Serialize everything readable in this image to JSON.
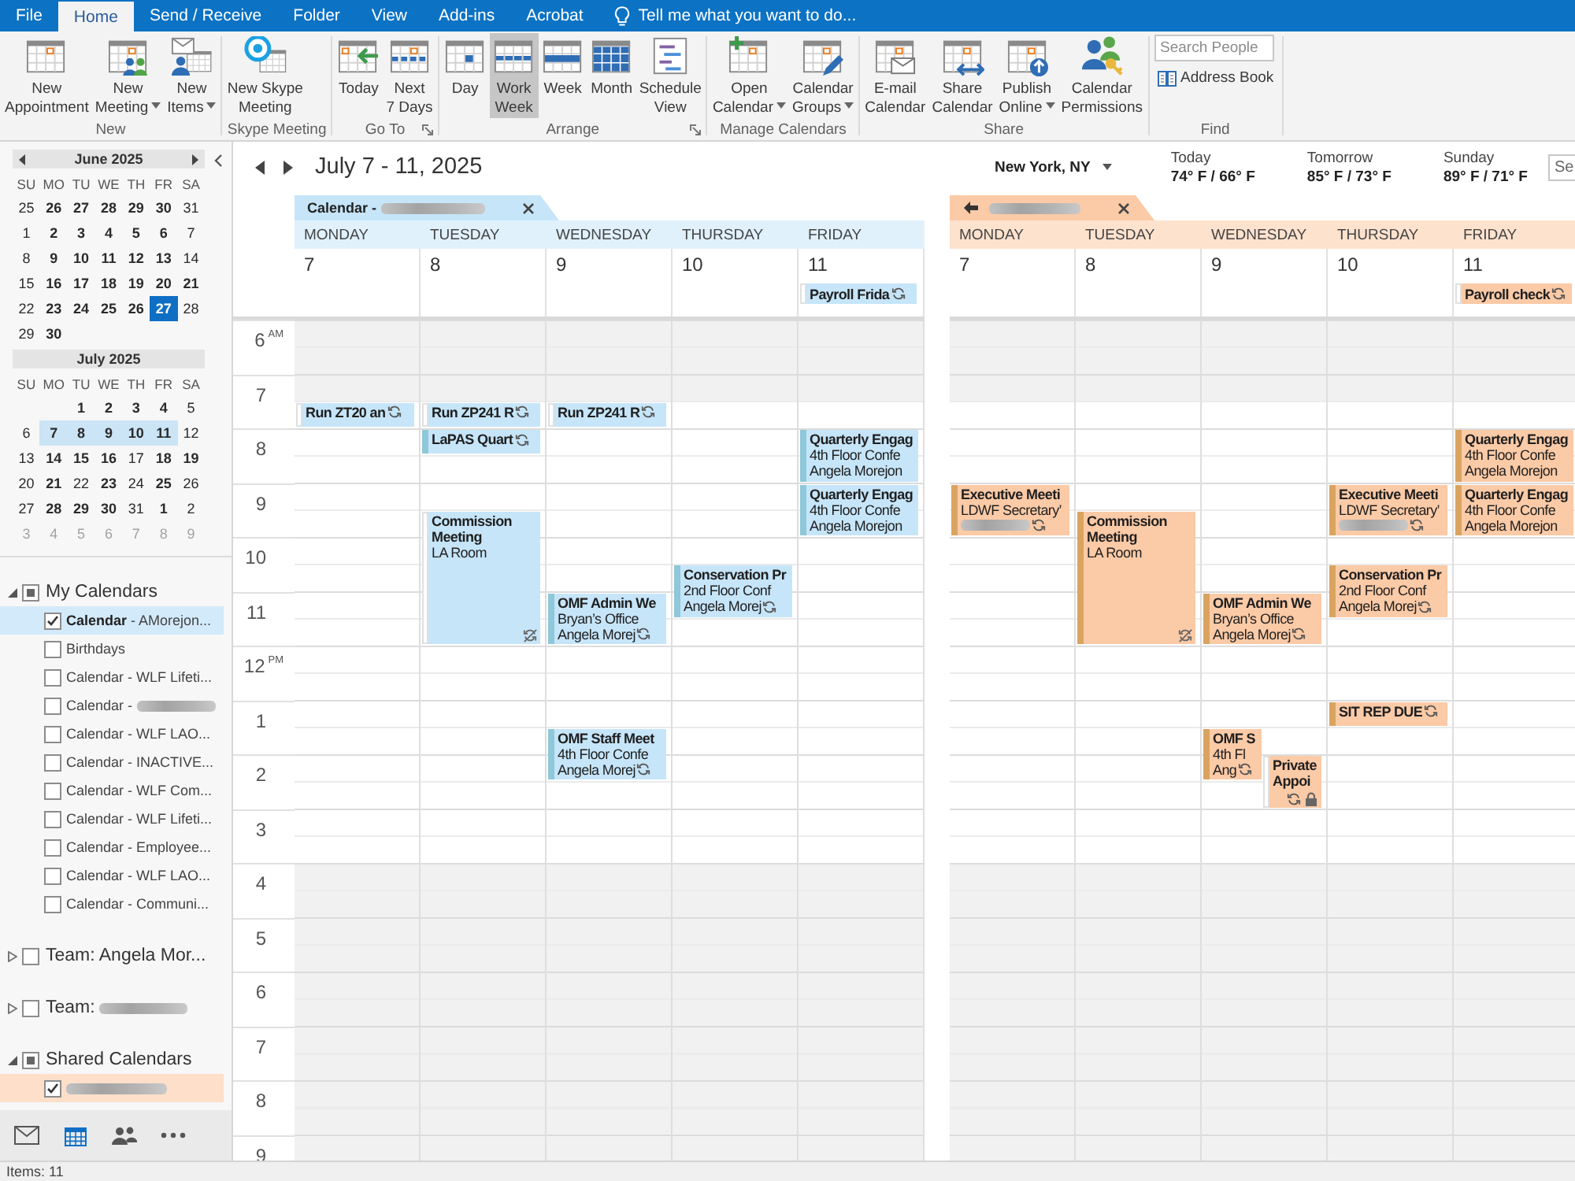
{
  "tabs": [
    {
      "label": "File",
      "selected": false
    },
    {
      "label": "Home",
      "selected": true
    },
    {
      "label": "Send / Receive",
      "selected": false
    },
    {
      "label": "Folder",
      "selected": false
    },
    {
      "label": "View",
      "selected": false
    },
    {
      "label": "Add-ins",
      "selected": false
    },
    {
      "label": "Acrobat",
      "selected": false
    }
  ],
  "tell_me": {
    "placeholder": "Tell me what you want to do..."
  },
  "ribbon": {
    "groups": [
      {
        "label": "New",
        "launcher": false,
        "buttons": [
          {
            "kind": "appointment",
            "label": "New\nAppointment",
            "dropdown": false
          },
          {
            "kind": "meeting",
            "label": "New\nMeeting",
            "dropdown": true
          },
          {
            "kind": "items",
            "label": "New\nItems",
            "dropdown": true
          }
        ]
      },
      {
        "label": "Skype Meeting",
        "launcher": false,
        "buttons": [
          {
            "kind": "skype",
            "label": "New Skype\nMeeting",
            "dropdown": false
          }
        ]
      },
      {
        "label": "Go To",
        "launcher": true,
        "buttons": [
          {
            "kind": "today",
            "label": "Today",
            "dropdown": false
          },
          {
            "kind": "next7",
            "label": "Next\n7 Days",
            "dropdown": false
          }
        ]
      },
      {
        "label": "Arrange",
        "launcher": true,
        "buttons": [
          {
            "kind": "day",
            "label": "Day",
            "dropdown": false,
            "selected": false
          },
          {
            "kind": "workweek",
            "label": "Work\nWeek",
            "dropdown": false,
            "selected": true
          },
          {
            "kind": "week",
            "label": "Week",
            "dropdown": false,
            "selected": false
          },
          {
            "kind": "month",
            "label": "Month",
            "dropdown": false,
            "selected": false
          },
          {
            "kind": "schedule",
            "label": "Schedule\nView",
            "dropdown": false,
            "selected": false
          }
        ]
      },
      {
        "label": "Manage Calendars",
        "launcher": false,
        "buttons": [
          {
            "kind": "open",
            "label": "Open\nCalendar",
            "dropdown": true
          },
          {
            "kind": "groups",
            "label": "Calendar\nGroups",
            "dropdown": true
          }
        ]
      },
      {
        "label": "Share",
        "launcher": false,
        "buttons": [
          {
            "kind": "email",
            "label": "E-mail\nCalendar",
            "dropdown": false
          },
          {
            "kind": "share",
            "label": "Share\nCalendar",
            "dropdown": false
          },
          {
            "kind": "publish",
            "label": "Publish\nOnline",
            "dropdown": true
          },
          {
            "kind": "permissions",
            "label": "Calendar\nPermissions",
            "dropdown": false
          }
        ]
      },
      {
        "label": "Find",
        "launcher": false,
        "search": {
          "placeholder": "Search People"
        },
        "links": [
          {
            "kind": "address-book",
            "label": "Address Book"
          }
        ]
      }
    ]
  },
  "navigator": {
    "months": [
      {
        "title": "June 2025",
        "arrows": true,
        "weekdays": [
          "SU",
          "MO",
          "TU",
          "WE",
          "TH",
          "FR",
          "SA"
        ],
        "weeks": [
          {
            "days": [
              {
                "day": "25",
                "bold": false,
                "muted": false,
                "selected": false,
                "today": false
              },
              {
                "day": "26",
                "bold": true,
                "muted": false,
                "selected": false,
                "today": false
              },
              {
                "day": "27",
                "bold": true,
                "muted": false,
                "selected": false,
                "today": false
              },
              {
                "day": "28",
                "bold": true,
                "muted": false,
                "selected": false,
                "today": false
              },
              {
                "day": "29",
                "bold": true,
                "muted": false,
                "selected": false,
                "today": false
              },
              {
                "day": "30",
                "bold": true,
                "muted": false,
                "selected": false,
                "today": false
              },
              {
                "day": "31",
                "bold": false,
                "muted": false,
                "selected": false,
                "today": false
              }
            ]
          },
          {
            "days": [
              {
                "day": "1",
                "bold": false,
                "muted": false,
                "selected": false,
                "today": false
              },
              {
                "day": "2",
                "bold": true,
                "muted": false,
                "selected": false,
                "today": false
              },
              {
                "day": "3",
                "bold": true,
                "muted": false,
                "selected": false,
                "today": false
              },
              {
                "day": "4",
                "bold": true,
                "muted": false,
                "selected": false,
                "today": false
              },
              {
                "day": "5",
                "bold": true,
                "muted": false,
                "selected": false,
                "today": false
              },
              {
                "day": "6",
                "bold": true,
                "muted": false,
                "selected": false,
                "today": false
              },
              {
                "day": "7",
                "bold": false,
                "muted": false,
                "selected": false,
                "today": false
              }
            ]
          },
          {
            "days": [
              {
                "day": "8",
                "bold": false,
                "muted": false,
                "selected": false,
                "today": false
              },
              {
                "day": "9",
                "bold": true,
                "muted": false,
                "selected": false,
                "today": false
              },
              {
                "day": "10",
                "bold": true,
                "muted": false,
                "selected": false,
                "today": false
              },
              {
                "day": "11",
                "bold": true,
                "muted": false,
                "selected": false,
                "today": false
              },
              {
                "day": "12",
                "bold": true,
                "muted": false,
                "selected": false,
                "today": false
              },
              {
                "day": "13",
                "bold": true,
                "muted": false,
                "selected": false,
                "today": false
              },
              {
                "day": "14",
                "bold": false,
                "muted": false,
                "selected": false,
                "today": false
              }
            ]
          },
          {
            "days": [
              {
                "day": "15",
                "bold": false,
                "muted": false,
                "selected": false,
                "today": false
              },
              {
                "day": "16",
                "bold": true,
                "muted": false,
                "selected": false,
                "today": false
              },
              {
                "day": "17",
                "bold": true,
                "muted": false,
                "selected": false,
                "today": false
              },
              {
                "day": "18",
                "bold": true,
                "muted": false,
                "selected": false,
                "today": false
              },
              {
                "day": "19",
                "bold": true,
                "muted": false,
                "selected": false,
                "today": false
              },
              {
                "day": "20",
                "bold": true,
                "muted": false,
                "selected": false,
                "today": false
              },
              {
                "day": "21",
                "bold": true,
                "muted": false,
                "selected": false,
                "today": false
              }
            ]
          },
          {
            "days": [
              {
                "day": "22",
                "bold": false,
                "muted": false,
                "selected": false,
                "today": false
              },
              {
                "day": "23",
                "bold": true,
                "muted": false,
                "selected": false,
                "today": false
              },
              {
                "day": "24",
                "bold": true,
                "muted": false,
                "selected": false,
                "today": false
              },
              {
                "day": "25",
                "bold": true,
                "muted": false,
                "selected": false,
                "today": false
              },
              {
                "day": "26",
                "bold": true,
                "muted": false,
                "selected": false,
                "today": false
              },
              {
                "day": "27",
                "bold": true,
                "muted": false,
                "selected": false,
                "today": true
              },
              {
                "day": "28",
                "bold": false,
                "muted": false,
                "selected": false,
                "today": false
              }
            ]
          },
          {
            "days": [
              {
                "day": "29",
                "bold": false,
                "muted": false,
                "selected": false,
                "today": false
              },
              {
                "day": "30",
                "bold": true,
                "muted": false,
                "selected": false,
                "today": false
              }
            ]
          }
        ]
      },
      {
        "title": "July 2025",
        "arrows": false,
        "weekdays": [
          "SU",
          "MO",
          "TU",
          "WE",
          "TH",
          "FR",
          "SA"
        ],
        "weeks": [
          {
            "trailing": true,
            "days": [
              {
                "day": "1",
                "bold": true,
                "muted": false,
                "selected": false,
                "today": false
              },
              {
                "day": "2",
                "bold": true,
                "muted": false,
                "selected": false,
                "today": false
              },
              {
                "day": "3",
                "bold": true,
                "muted": false,
                "selected": false,
                "today": false
              },
              {
                "day": "4",
                "bold": true,
                "muted": false,
                "selected": false,
                "today": false
              },
              {
                "day": "5",
                "bold": false,
                "muted": false,
                "selected": false,
                "today": false
              }
            ]
          },
          {
            "days": [
              {
                "day": "6",
                "bold": false,
                "muted": false,
                "selected": false,
                "today": false
              },
              {
                "day": "7",
                "bold": true,
                "muted": false,
                "selected": true,
                "today": false
              },
              {
                "day": "8",
                "bold": true,
                "muted": false,
                "selected": true,
                "today": false
              },
              {
                "day": "9",
                "bold": true,
                "muted": false,
                "selected": true,
                "today": false
              },
              {
                "day": "10",
                "bold": true,
                "muted": false,
                "selected": true,
                "today": false
              },
              {
                "day": "11",
                "bold": true,
                "muted": false,
                "selected": true,
                "today": false
              },
              {
                "day": "12",
                "bold": false,
                "muted": false,
                "selected": false,
                "today": false
              }
            ]
          },
          {
            "days": [
              {
                "day": "13",
                "bold": false,
                "muted": false,
                "selected": false,
                "today": false
              },
              {
                "day": "14",
                "bold": true,
                "muted": false,
                "selected": false,
                "today": false
              },
              {
                "day": "15",
                "bold": true,
                "muted": false,
                "selected": false,
                "today": false
              },
              {
                "day": "16",
                "bold": true,
                "muted": false,
                "selected": false,
                "today": false
              },
              {
                "day": "17",
                "bold": false,
                "muted": false,
                "selected": false,
                "today": false
              },
              {
                "day": "18",
                "bold": true,
                "muted": false,
                "selected": false,
                "today": false
              },
              {
                "day": "19",
                "bold": true,
                "muted": false,
                "selected": false,
                "today": false
              }
            ]
          },
          {
            "days": [
              {
                "day": "20",
                "bold": false,
                "muted": false,
                "selected": false,
                "today": false
              },
              {
                "day": "21",
                "bold": true,
                "muted": false,
                "selected": false,
                "today": false
              },
              {
                "day": "22",
                "bold": false,
                "muted": false,
                "selected": false,
                "today": false
              },
              {
                "day": "23",
                "bold": true,
                "muted": false,
                "selected": false,
                "today": false
              },
              {
                "day": "24",
                "bold": false,
                "muted": false,
                "selected": false,
                "today": false
              },
              {
                "day": "25",
                "bold": true,
                "muted": false,
                "selected": false,
                "today": false
              },
              {
                "day": "26",
                "bold": false,
                "muted": false,
                "selected": false,
                "today": false
              }
            ]
          },
          {
            "days": [
              {
                "day": "27",
                "bold": false,
                "muted": false,
                "selected": false,
                "today": false
              },
              {
                "day": "28",
                "bold": true,
                "muted": false,
                "selected": false,
                "today": false
              },
              {
                "day": "29",
                "bold": true,
                "muted": false,
                "selected": false,
                "today": false
              },
              {
                "day": "30",
                "bold": true,
                "muted": false,
                "selected": false,
                "today": false
              },
              {
                "day": "31",
                "bold": false,
                "muted": false,
                "selected": false,
                "today": false
              },
              {
                "day": "1",
                "bold": true,
                "muted": false,
                "selected": false,
                "today": false
              },
              {
                "day": "2",
                "bold": false,
                "muted": false,
                "selected": false,
                "today": false
              }
            ]
          },
          {
            "days": [
              {
                "day": "3",
                "bold": false,
                "muted": true,
                "selected": false,
                "today": false
              },
              {
                "day": "4",
                "bold": false,
                "muted": true,
                "selected": false,
                "today": false
              },
              {
                "day": "5",
                "bold": false,
                "muted": true,
                "selected": false,
                "today": false
              },
              {
                "day": "6",
                "bold": false,
                "muted": true,
                "selected": false,
                "today": false
              },
              {
                "day": "7",
                "bold": false,
                "muted": true,
                "selected": false,
                "today": false
              },
              {
                "day": "8",
                "bold": false,
                "muted": true,
                "selected": false,
                "today": false
              },
              {
                "day": "9",
                "bold": false,
                "muted": true,
                "selected": false,
                "today": false
              }
            ]
          }
        ]
      }
    ]
  },
  "folders": [
    {
      "label": "My Calendars",
      "expanded": true,
      "checked": true,
      "partial": true,
      "items": [
        {
          "label": "**Calendar** - AMorejon...",
          "checked": true,
          "color": "#d3eafa"
        },
        {
          "label": "Birthdays",
          "checked": false
        },
        {
          "label": "Calendar - WLF Lifeti...",
          "checked": false
        },
        {
          "label": "Calendar -",
          "redacted": true,
          "checked": false
        },
        {
          "label": "Calendar - WLF LAO...",
          "checked": false
        },
        {
          "label": "Calendar - INACTIVE...",
          "checked": false
        },
        {
          "label": "Calendar - WLF Com...",
          "checked": false
        },
        {
          "label": "Calendar - WLF Lifeti...",
          "checked": false
        },
        {
          "label": "Calendar - Employee...",
          "checked": false
        },
        {
          "label": "Calendar - WLF LAO...",
          "checked": false
        },
        {
          "label": "Calendar - Communi...",
          "checked": false
        }
      ]
    },
    {
      "label": "Team: Angela Mor...",
      "expanded": false,
      "checked": false
    },
    {
      "label": "Team:",
      "redacted": true,
      "expanded": false,
      "checked": false
    },
    {
      "label": "Shared Calendars",
      "expanded": true,
      "checked": true,
      "partial": true,
      "items": [
        {
          "redacted": true,
          "checked": true,
          "color": "#fddfca"
        }
      ]
    }
  ],
  "nav": [
    {
      "kind": "mail",
      "selected": false
    },
    {
      "kind": "calendar",
      "selected": true
    },
    {
      "kind": "people",
      "selected": false
    },
    {
      "kind": "more",
      "selected": false
    }
  ],
  "calendar": {
    "range": "July 7 - 11, 2025",
    "weather": {
      "location": "New York, NY",
      "forecast": [
        {
          "day": "Today",
          "temps": "74° F / 66° F"
        },
        {
          "day": "Tomorrow",
          "temps": "85° F / 73° F"
        },
        {
          "day": "Sunday",
          "temps": "89° F / 71° F"
        }
      ]
    },
    "search": {
      "placeholder": "Se"
    },
    "panes": [
      {
        "color": "#c6e5f9",
        "tab": {
          "label": "Calendar -",
          "redacted": true,
          "arrow": false
        },
        "time_labels": [
          "6$^{AM}$",
          "7",
          "8",
          "9",
          "10",
          "11",
          "12$^{PM}$",
          "1",
          "2",
          "3",
          "4",
          "5",
          "6",
          "7",
          "8",
          "9"
        ],
        "days": [
          {
            "name": "MONDAY",
            "date": "7",
            "events": [
              {
                "title": "Run ZT20 an",
                "busy": false,
                "recurring": true
              }
            ]
          },
          {
            "name": "TUESDAY",
            "date": "8",
            "events": [
              {
                "title": "Run ZP241 R",
                "busy": false,
                "recurring": true
              },
              {
                "title": "LaPAS Quart",
                "busy": true,
                "recurring": true
              },
              {
                "title": "Commission Meeting",
                "details": [
                  "LA Room"
                ],
                "busy": false,
                "recurring": true,
                "exception": true
              }
            ]
          },
          {
            "name": "WEDNESDAY",
            "date": "9",
            "events": [
              {
                "title": "Run ZP241 R",
                "busy": false,
                "recurring": true
              },
              {
                "title": "OMF Admin We",
                "details": [
                  "Bryan’s Office",
                  "Angela Morej"
                ],
                "busy": true,
                "recurring": true
              },
              {
                "title": "OMF Staff Meet",
                "details": [
                  "4th Floor Confe",
                  "Angela Morej"
                ],
                "busy": true,
                "recurring": true
              }
            ]
          },
          {
            "name": "THURSDAY",
            "date": "10",
            "events": [
              {
                "title": "Conservation Pr",
                "details": [
                  "2nd Floor Conf",
                  "Angela Morej"
                ],
                "busy": true,
                "recurring": true
              }
            ]
          },
          {
            "name": "FRIDAY",
            "date": "11",
            "all_day": [
              {
                "title": "Payroll Frida",
                "busy": false,
                "recurring": true
              }
            ],
            "events": [
              {
                "title": "Quarterly Engag",
                "details": [
                  "4th Floor Confe",
                  "Angela Morejon"
                ],
                "busy": true,
                "recurring": false
              },
              {
                "title": "Quarterly Engag",
                "details": [
                  "4th Floor Confe",
                  "Angela Morejon"
                ],
                "busy": true,
                "recurring": false
              }
            ]
          }
        ]
      },
      {
        "color": "#fbcaa6",
        "tab": {
          "redacted": true,
          "arrow": true
        },
        "days": [
          {
            "name": "MONDAY",
            "date": "7",
            "events": [
              {
                "title": "Executive Meeti",
                "details": [
                  "LDWF Secretary’"
                ],
                "redacted": true,
                "busy": true,
                "recurring": true
              }
            ]
          },
          {
            "name": "TUESDAY",
            "date": "8",
            "events": [
              {
                "title": "Commission Meeting",
                "details": [
                  "LA Room"
                ],
                "busy": true,
                "recurring": true,
                "exception": true
              }
            ]
          },
          {
            "name": "WEDNESDAY",
            "date": "9",
            "events": [
              {
                "title": "OMF Admin We",
                "details": [
                  "Bryan’s Office",
                  "Angela Morej"
                ],
                "busy": true,
                "recurring": true
              },
              {
                "title": "OMF S",
                "details": [
                  "4th Fl",
                  "Ang"
                ],
                "busy": true,
                "recurring": true
              },
              {
                "title": "Private Appoi",
                "busy": false,
                "recurring": true,
                "private": true
              }
            ]
          },
          {
            "name": "THURSDAY",
            "date": "10",
            "events": [
              {
                "title": "Executive Meeti",
                "details": [
                  "LDWF Secretary’"
                ],
                "redacted": true,
                "busy": true,
                "recurring": true
              },
              {
                "title": "Conservation Pr",
                "details": [
                  "2nd Floor Conf",
                  "Angela Morej"
                ],
                "busy": true,
                "recurring": true
              },
              {
                "title": "SIT REP DUE",
                "busy": true,
                "recurring": true
              }
            ]
          },
          {
            "name": "FRIDAY",
            "date": "11",
            "all_day": [
              {
                "title": "Payroll check",
                "busy": false,
                "recurring": true
              }
            ],
            "events": [
              {
                "title": "Quarterly Engag",
                "details": [
                  "4th Floor Confe",
                  "Angela Morejon"
                ],
                "busy": true,
                "recurring": false
              },
              {
                "title": "Quarterly Engag",
                "details": [
                  "4th Floor Confe",
                  "Angela Morejon"
                ],
                "busy": true,
                "recurring": false
              }
            ]
          }
        ]
      }
    ]
  },
  "status_bar": {
    "text": "Items: 11"
  }
}
